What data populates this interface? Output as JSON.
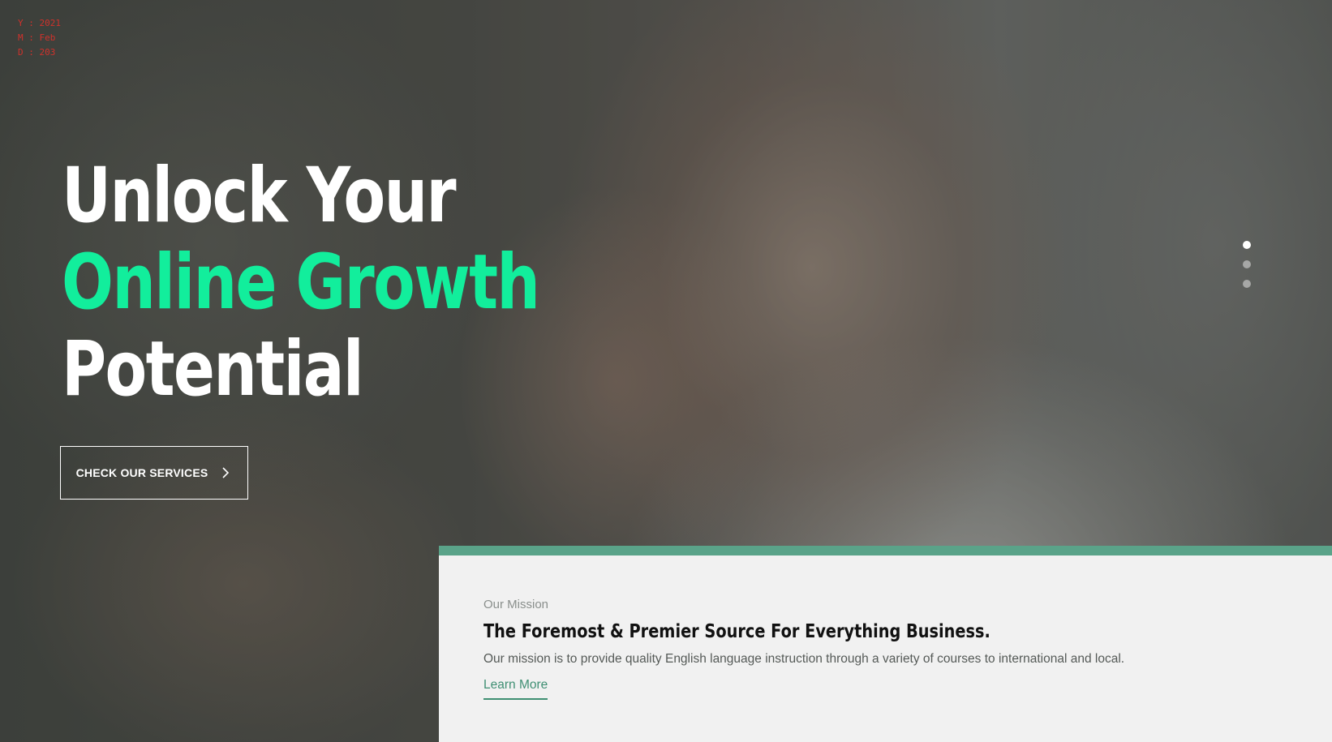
{
  "debug_readout": {
    "line1": "Y : 2021",
    "line2": "M : Feb",
    "line3": "D : 203"
  },
  "hero": {
    "headline_line1": "Unlock Your",
    "headline_line2": "Online Growth",
    "headline_line3": "Potential",
    "cta_label": "CHECK OUR SERVICES",
    "cta_icon": "chevron-right-icon",
    "slides": {
      "count": 3,
      "active_index": 0
    }
  },
  "mission": {
    "eyebrow": "Our Mission",
    "title": "The Foremost & Premier Source For Everything Business.",
    "description": "Our mission is to provide quality English language instruction through a variety of courses to international and local.",
    "link_label": "Learn More"
  },
  "colors": {
    "accent_green": "#12ee9c",
    "mission_border": "#5aa389",
    "link_green": "#3f8f73",
    "panel_background": "#f1f1f1"
  }
}
